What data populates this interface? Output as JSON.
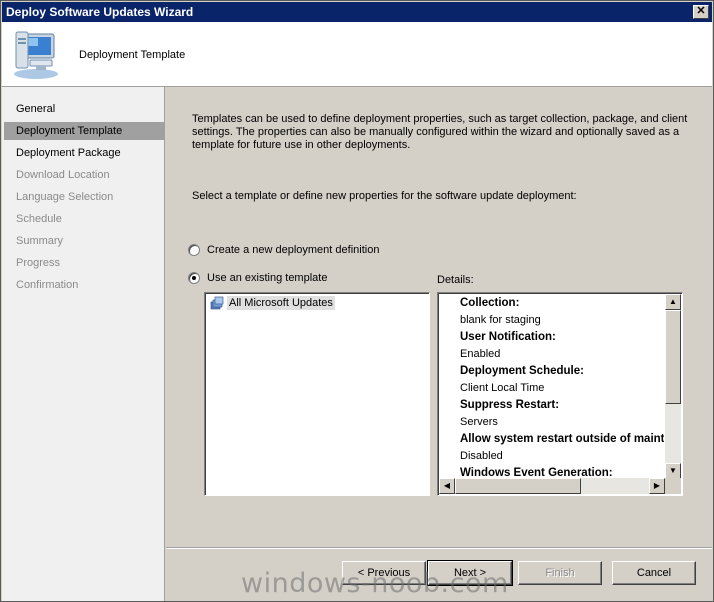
{
  "window": {
    "title": "Deploy Software Updates Wizard",
    "close_label": "✕"
  },
  "header": {
    "title": "Deployment Template",
    "icon": "computer-icon"
  },
  "sidebar": {
    "items": [
      {
        "label": "General",
        "state": "normal"
      },
      {
        "label": "Deployment Template",
        "state": "active"
      },
      {
        "label": "Deployment Package",
        "state": "normal"
      },
      {
        "label": "Download Location",
        "state": "disabled"
      },
      {
        "label": "Language Selection",
        "state": "disabled"
      },
      {
        "label": "Schedule",
        "state": "disabled"
      },
      {
        "label": "Summary",
        "state": "disabled"
      },
      {
        "label": "Progress",
        "state": "disabled"
      },
      {
        "label": "Confirmation",
        "state": "disabled"
      }
    ]
  },
  "main": {
    "description": "Templates can be used to define deployment properties, such as target collection, package, and client settings. The properties can also be manually configured within the wizard and optionally saved as a template for future use in other deployments.",
    "prompt": "Select a template or define new properties for the software update deployment:",
    "radio_new": {
      "label": "Create a new deployment definition",
      "checked": false
    },
    "radio_existing": {
      "label": "Use an existing template",
      "checked": true
    },
    "templates": [
      {
        "label": "All Microsoft Updates",
        "icon": "template-icon"
      }
    ],
    "details_label": "Details:",
    "details": [
      {
        "kind": "key",
        "text": "Collection:"
      },
      {
        "kind": "val",
        "text": "blank for staging"
      },
      {
        "kind": "key",
        "text": "User Notification:"
      },
      {
        "kind": "val",
        "text": "Enabled"
      },
      {
        "kind": "key",
        "text": "Deployment Schedule:"
      },
      {
        "kind": "val",
        "text": "Client Local Time"
      },
      {
        "kind": "key",
        "text": "Suppress Restart:"
      },
      {
        "kind": "val",
        "text": "Servers"
      },
      {
        "kind": "key",
        "text": "Allow system restart outside of maint"
      },
      {
        "kind": "val",
        "text": "Disabled"
      },
      {
        "kind": "key",
        "text": "Windows Event Generation:"
      }
    ]
  },
  "buttons": {
    "previous": "< Previous",
    "next": "Next >",
    "finish": "Finish",
    "cancel": "Cancel"
  },
  "watermark": "windows-noob.com"
}
